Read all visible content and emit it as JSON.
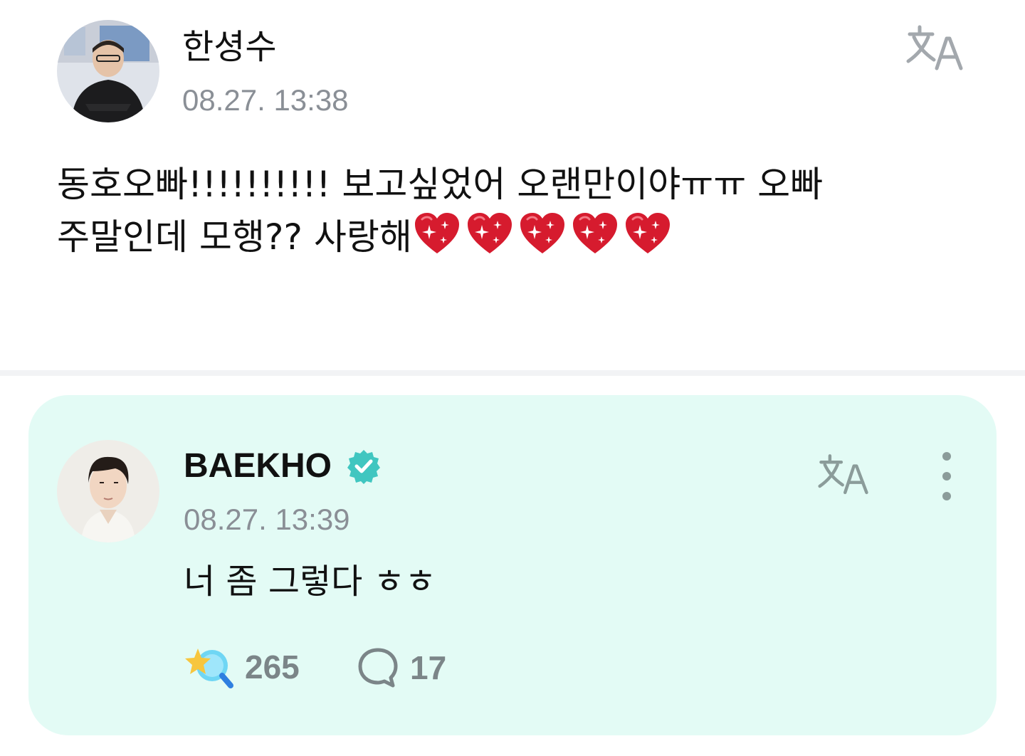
{
  "post": {
    "author": "한셩수",
    "timestamp": "08.27. 13:38",
    "avatar_icon": "user-avatar",
    "translate_icon": "translate-icon",
    "body_line_1": "동호오빠!!!!!!!!!! 보고싶었어 오랜만이야ㅠㅠ 오빠",
    "body_line_2": "주말인데 모행?? 사랑해",
    "emoji": "sparkling-heart",
    "emoji_count": 5
  },
  "reply": {
    "author": "BAEKHO",
    "verified": true,
    "timestamp": "08.27. 13:39",
    "body": "너 좀 그렇다 ㅎㅎ",
    "like_icon": "star-wand-icon",
    "like_count": "265",
    "comment_icon": "comment-icon",
    "comment_count": "17",
    "translate_icon": "translate-icon",
    "more_icon": "more-vertical-icon"
  },
  "colors": {
    "reply_background": "#e3fbf5",
    "verified_badge": "#40c6c0",
    "muted_text": "#8a8f96",
    "heart": "#d61b2e"
  }
}
